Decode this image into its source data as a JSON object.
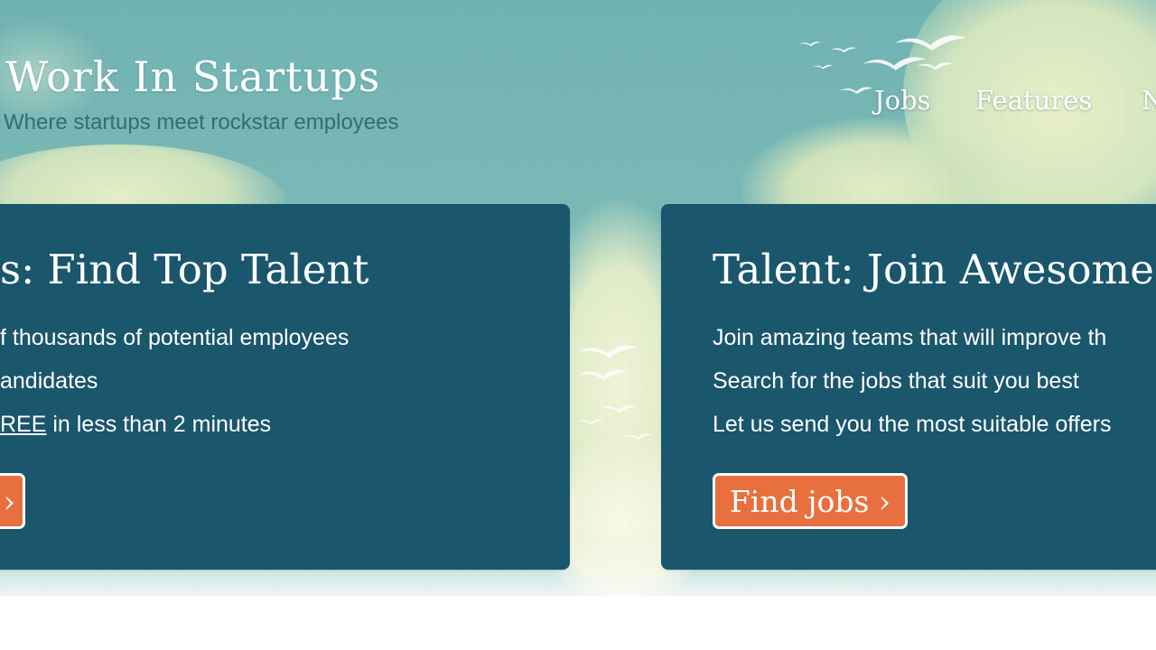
{
  "header": {
    "logo_text": "Work In Startups",
    "tagline": "Where startups meet rockstar employees"
  },
  "nav": {
    "items": [
      {
        "label": "Jobs"
      },
      {
        "label": "Features"
      },
      {
        "label": "N"
      }
    ]
  },
  "panels": {
    "employers": {
      "title": "s: Find Top Talent",
      "bullets": [
        {
          "text": "f thousands of potential employees"
        },
        {
          "text": "andidates"
        },
        {
          "underlined": "REE",
          "text": " in less than 2 minutes"
        }
      ],
      "button_label": "›"
    },
    "talent": {
      "title": "Talent: Join Awesome",
      "bullets": [
        {
          "text": "Join amazing teams that will improve th"
        },
        {
          "text": "Search for the jobs that suit you best"
        },
        {
          "text": "Let us send you the most suitable offers"
        }
      ],
      "button_label": "Find jobs ›"
    }
  },
  "colors": {
    "sky": "#79b9b6",
    "panel": "#1a566c",
    "button": "#e8703f",
    "tagline": "#2e6f73"
  },
  "icons": [
    "bird-icon",
    "cloud-decoration"
  ]
}
